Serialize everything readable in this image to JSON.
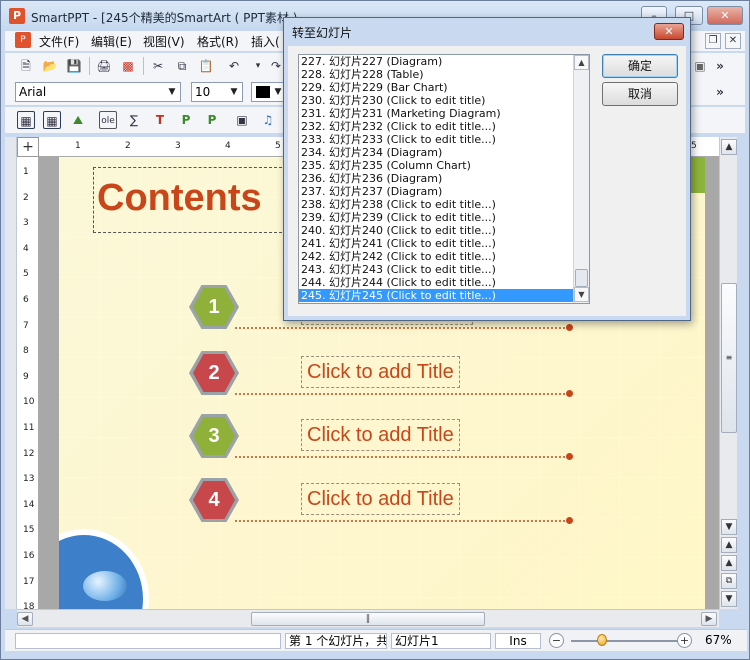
{
  "window": {
    "title": "SmartPPT - [245个精美的SmartArt ( PPT素材 ) ...",
    "minimize": "–",
    "maximize": "□",
    "close": "✕"
  },
  "menu": {
    "items": [
      "文件(F)",
      "编辑(E)",
      "视图(V)",
      "格式(R)",
      "插入("
    ],
    "restore": "❐",
    "close": "✕"
  },
  "toolbar": {
    "font": "Arial",
    "size": "10",
    "icons_row1": [
      "new-icon",
      "open-icon",
      "save-icon",
      "print-icon",
      "pdf-icon",
      "cut-icon",
      "copy-icon",
      "paste-icon",
      "undo-icon",
      "redo-icon"
    ],
    "icons_row3": [
      "table-icon",
      "grid-icon",
      "image-icon",
      "ole-icon",
      "formula-icon",
      "text-icon",
      "p-icon",
      "p2-icon",
      "slide-icon",
      "media-icon"
    ],
    "overflow": "»"
  },
  "ruler": {
    "h_numbers": [
      "1",
      "2",
      "3",
      "4",
      "5"
    ],
    "h_end": "5",
    "v_numbers": [
      "1",
      "2",
      "3",
      "4",
      "5",
      "6",
      "7",
      "8",
      "9",
      "10",
      "11",
      "12",
      "13",
      "14",
      "15",
      "16",
      "17",
      "18"
    ]
  },
  "slide": {
    "title": "Contents",
    "items": [
      {
        "number": "1",
        "label": "",
        "color": "#8fb13a"
      },
      {
        "number": "2",
        "label": "Click to add Title",
        "color": "#c7474a"
      },
      {
        "number": "3",
        "label": "Click to add Title",
        "color": "#8fb13a"
      },
      {
        "number": "4",
        "label": "Click to add Title",
        "color": "#c7474a"
      }
    ],
    "accent": "#c8461a"
  },
  "statusbar": {
    "slide_position": "第 1 个幻灯片，共",
    "slide_name": "幻灯片1",
    "mode": "Ins",
    "zoom": "67%",
    "zoom_minus": "−",
    "zoom_plus": "+"
  },
  "dialog": {
    "title": "转至幻灯片",
    "ok": "确定",
    "cancel": "取消",
    "close": "✕",
    "slides": [
      "227. 幻灯片227 (Diagram)",
      "228. 幻灯片228 (Table)",
      "229. 幻灯片229 (Bar Chart)",
      "230. 幻灯片230 (Click to edit title)",
      "231. 幻灯片231 (Marketing Diagram)",
      "232. 幻灯片232 (Click to edit title...)",
      "233. 幻灯片233 (Click to edit title...)",
      "234. 幻灯片234 (Diagram)",
      "235. 幻灯片235 (Column Chart)",
      "236. 幻灯片236 (Diagram)",
      "237. 幻灯片237 (Diagram)",
      "238. 幻灯片238 (Click to edit title...)",
      "239. 幻灯片239 (Click to edit title...)",
      "240. 幻灯片240 (Click to edit title...)",
      "241. 幻灯片241 (Click to edit title...)",
      "242. 幻灯片242 (Click to edit title...)",
      "243. 幻灯片243 (Click to edit title...)",
      "244. 幻灯片244 (Click to edit title...)",
      "245. 幻灯片245 (Click to edit title...)"
    ],
    "selected_index": 18
  }
}
